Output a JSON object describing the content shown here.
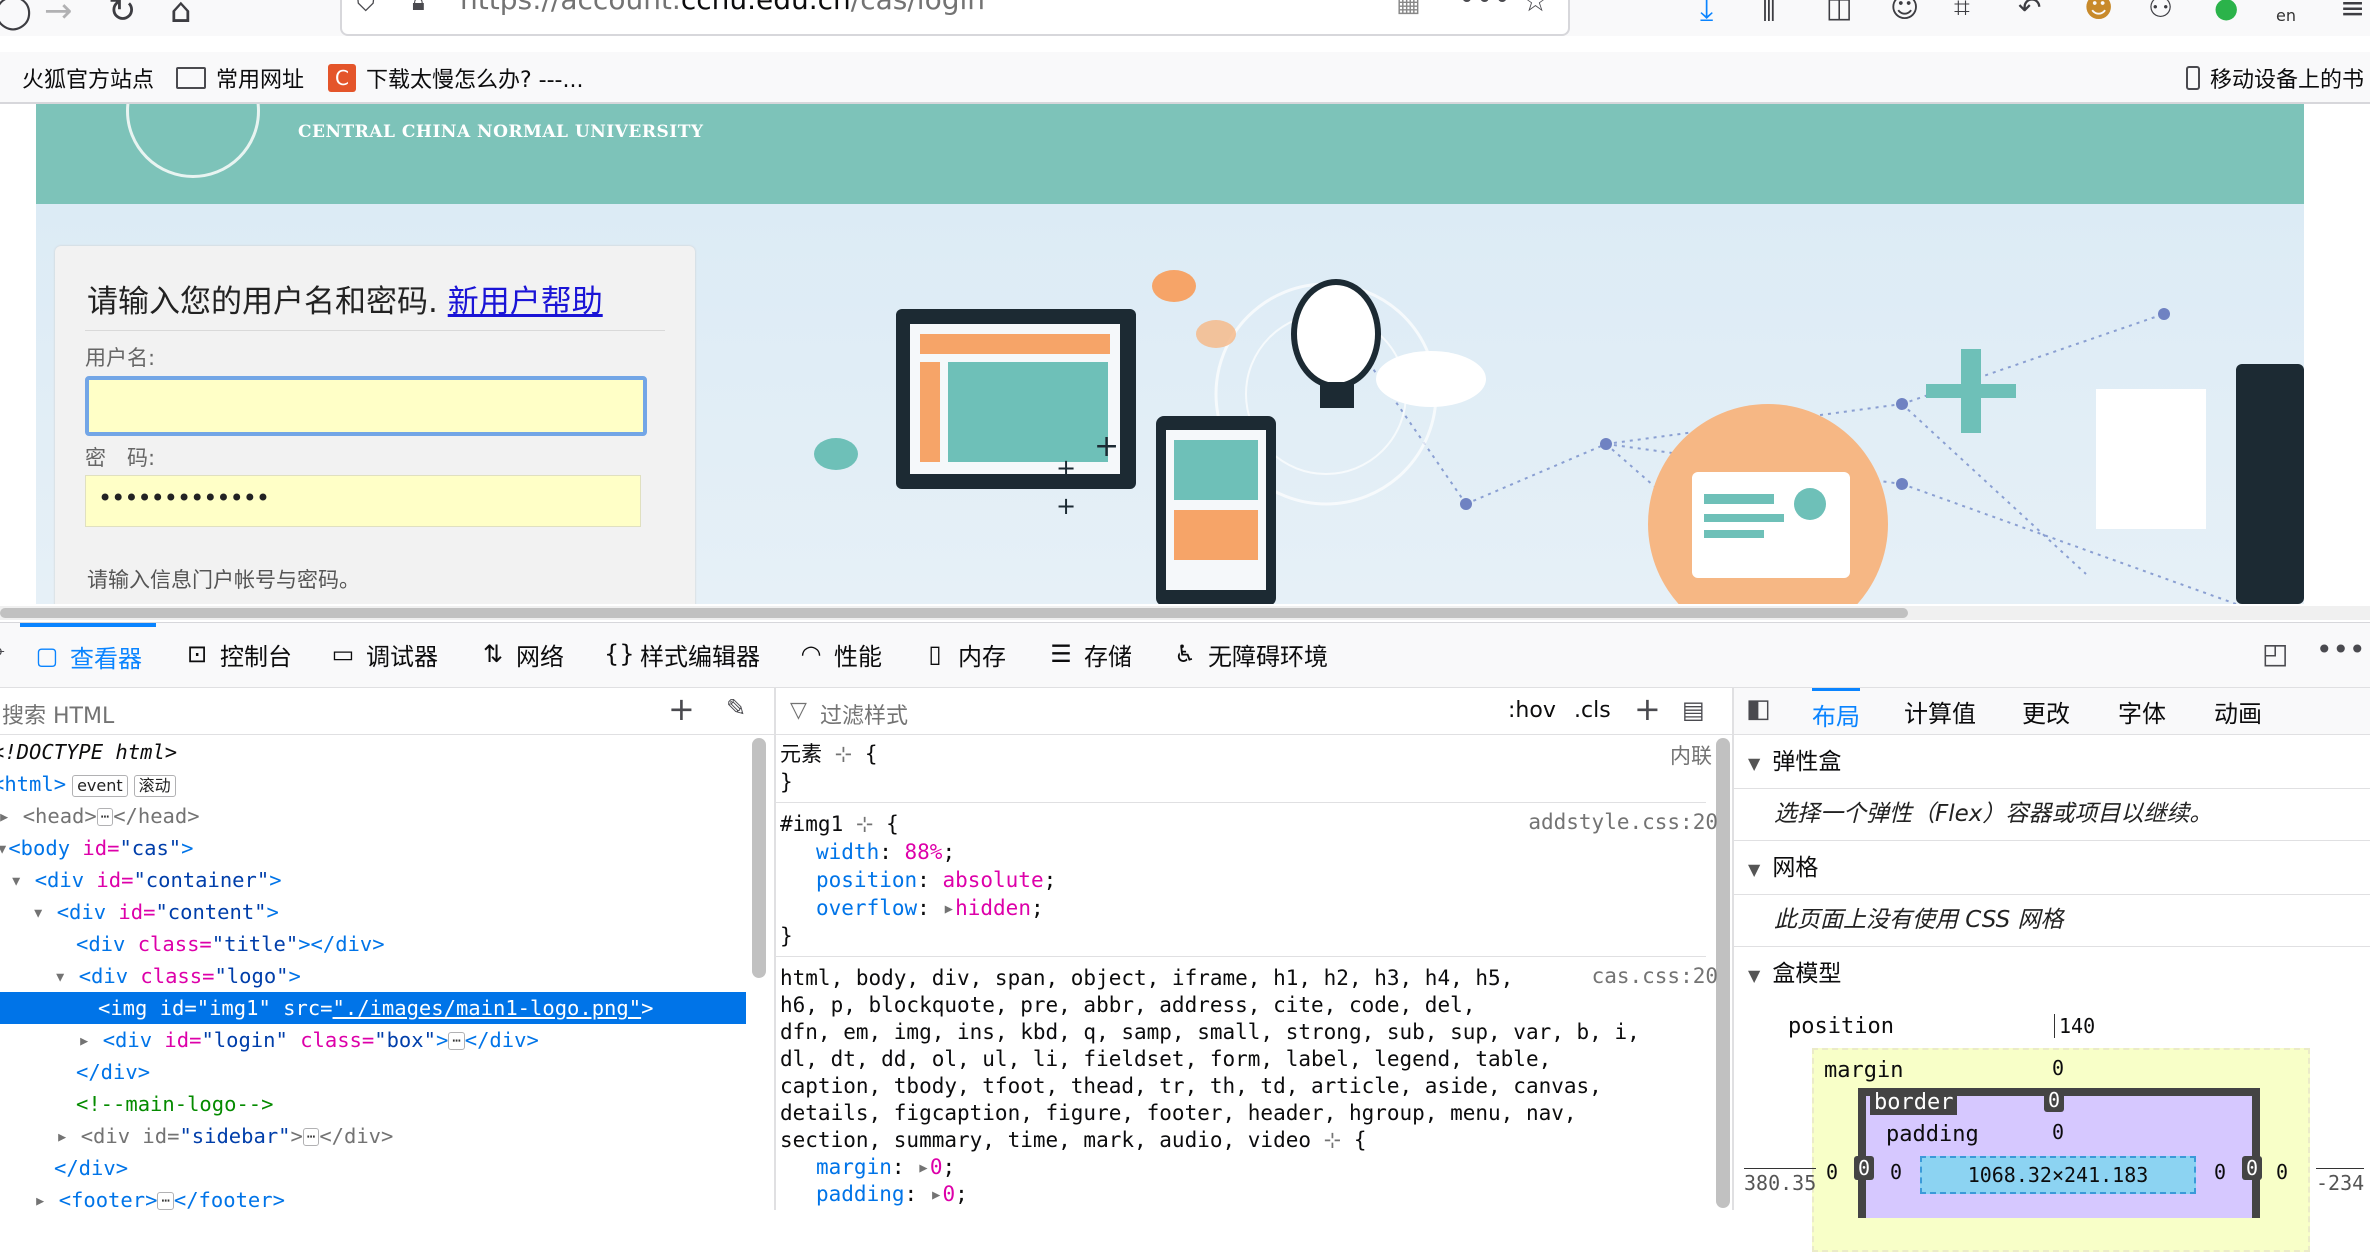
{
  "browser": {
    "url_prefix": "https://account.",
    "url_domain": "ccnu.edu.cn",
    "url_path": "/cas/login",
    "bookmarks": [
      {
        "label": "火狐官方站点",
        "icon": "firefox-icon"
      },
      {
        "label": "常用网址",
        "icon": "folder-icon"
      },
      {
        "label": "下载太慢怎么办? ---...",
        "icon": "c-logo-icon"
      }
    ],
    "mobile_bookmarks": "移动设备上的书",
    "toolbar_badge": "en"
  },
  "page": {
    "university_en": "CENTRAL CHINA NORMAL UNIVERSITY",
    "login_heading": "请输入您的用户名和密码.",
    "help_link": "新用户帮助",
    "username_label": "用户名:",
    "username_value": "",
    "password_label": "密　码:",
    "password_value": "•••••••••••••",
    "hint": "请输入信息门户帐号与密码。",
    "colors": {
      "header": "#7dc3b9",
      "banner": "#dcebf5",
      "input_bg": "#ffffc7",
      "focus": "#73a6e6",
      "link": "#1a14d6"
    }
  },
  "devtools": {
    "tabs": [
      {
        "label": "查看器",
        "icon": "inspector-icon",
        "selected": true
      },
      {
        "label": "控制台",
        "icon": "console-icon"
      },
      {
        "label": "调试器",
        "icon": "debugger-icon"
      },
      {
        "label": "网络",
        "icon": "network-icon"
      },
      {
        "label": "样式编辑器",
        "icon": "style-editor-icon"
      },
      {
        "label": "性能",
        "icon": "performance-icon"
      },
      {
        "label": "内存",
        "icon": "memory-icon"
      },
      {
        "label": "存储",
        "icon": "storage-icon"
      },
      {
        "label": "无障碍环境",
        "icon": "accessibility-icon"
      }
    ],
    "inspector": {
      "search_placeholder": "搜索 HTML",
      "tree": {
        "doctype": "<!DOCTYPE html>",
        "html_open": "<html>",
        "event_badge": "event",
        "scroll_badge": "滚动",
        "head_open": "<head>",
        "head_close": "</head>",
        "body_tag": "<body",
        "body_attr": "id=",
        "body_val": "\"cas\"",
        "container_tag": "<div",
        "container_attr": "id=",
        "container_val": "\"container\"",
        "content_attr": "id=",
        "content_val": "\"content\"",
        "title_attr": "class=",
        "title_val": "\"title\"",
        "title_close": "></div>",
        "logo_attr": "class=",
        "logo_val": "\"logo\"",
        "img_tag": "<img",
        "img_id_attr": "id=",
        "img_id_val": "\"img1\"",
        "img_src_attr": "src=",
        "img_src_val": "\"./images/main1-logo.png\"",
        "login_attr1": "id=",
        "login_val1": "\"login\"",
        "login_attr2": "class=",
        "login_val2": "\"box\"",
        "div_close": "</div>",
        "comment": "<!--main-logo-->",
        "sidebar_attr": "id=",
        "sidebar_val": "\"sidebar\"",
        "footer_open": "<footer>",
        "footer_close": "</footer>",
        "gt": ">",
        "div_open": "<div"
      }
    },
    "rules": {
      "filter_placeholder": "过滤样式",
      "hov": ":hov",
      "cls": ".cls",
      "element_label": "元素",
      "element_src": "内联",
      "img1_selector": "#img1",
      "img1_src": "addstyle.css:20",
      "width_prop": "width",
      "width_val": "88%",
      "position_prop": "position",
      "position_val": "absolute",
      "overflow_prop": "overflow",
      "overflow_val": "hidden",
      "reset_lines": [
        "html, body, div, span, object, iframe, h1, h2, h3, h4, h5,",
        "h6, p, blockquote, pre, abbr, address, cite, code, del,",
        "dfn, em, img, ins, kbd, q, samp, small, strong, sub, sup, var, b, i,",
        "dl, dt, dd, ol, ul, li, fieldset, form, label, legend, table,",
        "caption, tbody, tfoot, thead, tr, th, td, article, aside, canvas,",
        "details, figcaption, figure, footer, header, hgroup, menu, nav,",
        "section, summary, time, mark, audio, video"
      ],
      "reset_src": "cas.css:20",
      "margin_prop": "margin",
      "margin_val": "0",
      "padding_prop": "padding",
      "padding_val": "0"
    },
    "layout": {
      "tabs": [
        "布局",
        "计算值",
        "更改",
        "字体",
        "动画"
      ],
      "flex_title": "弹性盒",
      "flex_msg": "选择一个弹性（Flex）容器或项目以继续。",
      "grid_title": "网格",
      "grid_msg": "此页面上没有使用 CSS 网格",
      "box_title": "盒模型",
      "position_label": "position",
      "position_top": "140",
      "margin_label": "margin",
      "margin_top": "0",
      "border_label": "border",
      "border_top": "0",
      "padding_label": "padding",
      "padding_top": "0",
      "content_size": "1068.32×241.183",
      "left_offset": "380.35",
      "right_offset": "-234",
      "side_zero": "0"
    }
  }
}
